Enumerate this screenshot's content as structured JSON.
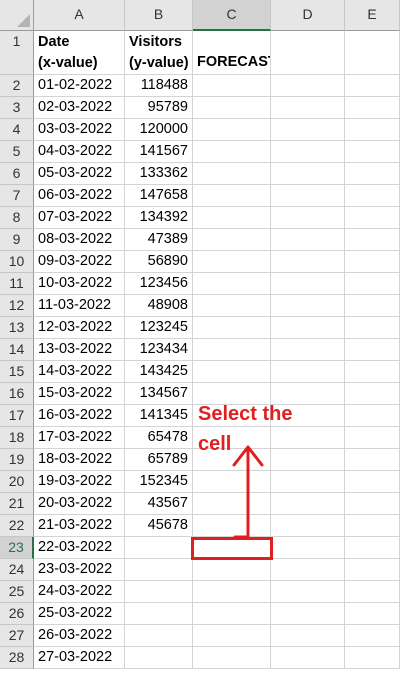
{
  "columns": [
    "A",
    "B",
    "C",
    "D",
    "E"
  ],
  "active_column": "C",
  "active_row": 23,
  "header_row": {
    "a": [
      "Date",
      "(x-value)"
    ],
    "b": [
      "Visitors",
      "(y-value)"
    ],
    "c": "FORECAST"
  },
  "rows": [
    {
      "row": "2",
      "date": "01-02-2022",
      "visitors": "118488"
    },
    {
      "row": "3",
      "date": "02-03-2022",
      "visitors": "95789"
    },
    {
      "row": "4",
      "date": "03-03-2022",
      "visitors": "120000"
    },
    {
      "row": "5",
      "date": "04-03-2022",
      "visitors": "141567"
    },
    {
      "row": "6",
      "date": "05-03-2022",
      "visitors": "133362"
    },
    {
      "row": "7",
      "date": "06-03-2022",
      "visitors": "147658"
    },
    {
      "row": "8",
      "date": "07-03-2022",
      "visitors": "134392"
    },
    {
      "row": "9",
      "date": "08-03-2022",
      "visitors": "47389"
    },
    {
      "row": "10",
      "date": "09-03-2022",
      "visitors": "56890"
    },
    {
      "row": "11",
      "date": "10-03-2022",
      "visitors": "123456"
    },
    {
      "row": "12",
      "date": "11-03-2022",
      "visitors": "48908"
    },
    {
      "row": "13",
      "date": "12-03-2022",
      "visitors": "123245"
    },
    {
      "row": "14",
      "date": "13-03-2022",
      "visitors": "123434"
    },
    {
      "row": "15",
      "date": "14-03-2022",
      "visitors": "143425"
    },
    {
      "row": "16",
      "date": "15-03-2022",
      "visitors": "134567"
    },
    {
      "row": "17",
      "date": "16-03-2022",
      "visitors": "141345"
    },
    {
      "row": "18",
      "date": "17-03-2022",
      "visitors": "65478"
    },
    {
      "row": "19",
      "date": "18-03-2022",
      "visitors": "65789"
    },
    {
      "row": "20",
      "date": "19-03-2022",
      "visitors": "152345"
    },
    {
      "row": "21",
      "date": "20-03-2022",
      "visitors": "43567"
    },
    {
      "row": "22",
      "date": "21-03-2022",
      "visitors": "45678"
    },
    {
      "row": "23",
      "date": "22-03-2022",
      "visitors": ""
    },
    {
      "row": "24",
      "date": "23-03-2022",
      "visitors": ""
    },
    {
      "row": "25",
      "date": "24-03-2022",
      "visitors": ""
    },
    {
      "row": "26",
      "date": "25-03-2022",
      "visitors": ""
    },
    {
      "row": "27",
      "date": "26-03-2022",
      "visitors": ""
    },
    {
      "row": "28",
      "date": "27-03-2022",
      "visitors": ""
    }
  ],
  "annotation": {
    "text_line1": "Select the",
    "text_line2": "cell",
    "color": "#e02020"
  },
  "colors": {
    "header_bg": "#e6e6e6",
    "selection": "#217346",
    "annotation": "#e02020"
  }
}
